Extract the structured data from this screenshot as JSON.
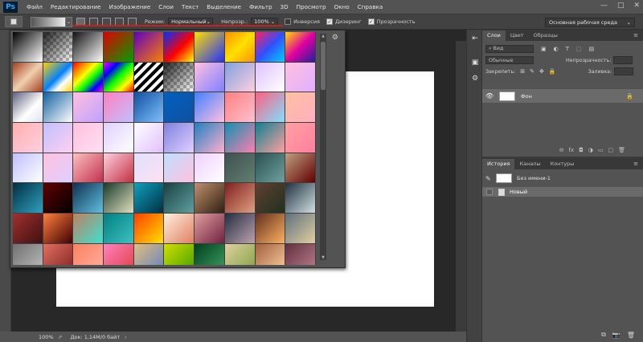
{
  "app": {
    "logo": "Ps"
  },
  "menu": [
    "Файл",
    "Редактирование",
    "Изображение",
    "Слои",
    "Текст",
    "Выделение",
    "Фильтр",
    "3D",
    "Просмотр",
    "Окно",
    "Справка"
  ],
  "window_controls": {
    "minimize": "—",
    "maximize": "□",
    "close": "✕"
  },
  "options": {
    "mode_label": "Режим:",
    "mode_value": "Нормальный",
    "opacity_label": "Непрозр.:",
    "opacity_value": "100%",
    "inverse_label": "Инверсия",
    "dither_label": "Дизеринг",
    "transparency_label": "Прозрачность",
    "inverse_checked": false,
    "dither_checked": true,
    "transparency_checked": true,
    "workspace": "Основная рабочая среда",
    "dropdown_arrow": "⌄",
    "underline_color": "#c8201f"
  },
  "gradient_picker": {
    "gear": "⚙",
    "scroll_up": "▲",
    "scroll_down": "▼",
    "rows": [
      [
        "linear-gradient(135deg,#000 0%,#fff 100%)",
        "checker",
        "linear-gradient(135deg,#111 0%,#fff 100%)",
        "linear-gradient(135deg,#e00000 0%,#00a000 100%)",
        "linear-gradient(135deg,#6000c0 0%,#ff8000 100%)",
        "linear-gradient(135deg,#0030ff 0%,#ff0000 55%,#ffff00 100%)",
        "linear-gradient(135deg,#ffe000 0%,#2030ff 100%)",
        "linear-gradient(135deg,#ff9000 0%,#ffe000 50%,#ff9000 100%)",
        "linear-gradient(135deg,#ff2060 0%,#3050ff 50%,#00d0ff 100%)",
        "linear-gradient(135deg,#ffe000 0%,#e000a0 50%,#2020a0 100%)"
      ],
      [
        "linear-gradient(135deg,#a04020 0%,#f0d0b0 50%,#a04020 100%)",
        "linear-gradient(135deg,#ffd000 0%,#0080ff 50%,#fff 70%,#ffd000 100%)",
        "linear-gradient(135deg,#ff0000,#ff8000,#ffff00,#00ff00,#0000ff,#ff00ff)",
        "linear-gradient(135deg,#ff00ff,#0000ff,#00ff00,#ffff00,#ff0000)",
        "repeating-linear-gradient(135deg,#000 0,#000 4px,#fff 4px,#fff 8px)",
        "checker",
        "linear-gradient(135deg,#ffc0e0 0%,#8080ff 100%)",
        "linear-gradient(135deg,#80a0e0 0%,#ffd0e0 100%)",
        "linear-gradient(135deg,#e0c0ff 0%,#ffffff 100%)",
        "linear-gradient(135deg,#ffc0e0 0%,#e0b0ff 100%)"
      ],
      [
        "linear-gradient(135deg,#606080 0%,#ffffff 60%,#e0e0f0 100%)",
        "linear-gradient(135deg,#1060a0 0%,#ffffff 100%)",
        "linear-gradient(135deg,#ffc0e0 0%,#c0a0ff 100%)",
        "linear-gradient(135deg,#ff80c0 0%,#c0c0ff 100%)",
        "linear-gradient(135deg,#1050a0 0%,#80c0ff 100%)",
        "linear-gradient(135deg,#0060c0 0%,#1050a0 100%)",
        "linear-gradient(135deg,#4080ff 0%,#ffc0e0 100%)",
        "linear-gradient(135deg,#ff8080 0%,#ffc0d0 100%)",
        "linear-gradient(135deg,#ff6080 0%,#80e0ff 100%)",
        "linear-gradient(135deg,#ffc0a0 0%,#ffb0c0 100%)"
      ],
      [
        "linear-gradient(135deg,#ffb0b0 0%,#ffd0e0 100%)",
        "linear-gradient(135deg,#c0c0ff 0%,#ffd0f0 100%)",
        "linear-gradient(135deg,#ffc0e0 0%,#ffe0f0 100%)",
        "linear-gradient(135deg,#e0d0ff 0%,#ffffff 100%)",
        "linear-gradient(135deg,#ffffff 0%,#e0c0ff 100%)",
        "linear-gradient(135deg,#8080e0 0%,#e0d0ff 100%)",
        "linear-gradient(135deg,#2080c0 0%,#ffb0d0 100%)",
        "linear-gradient(135deg,#1090b0 0%,#ff80b0 100%)",
        "linear-gradient(135deg,#108090 0%,#ffa0a0 100%)",
        "linear-gradient(135deg,#ffa0a0 0%,#ff80a0 100%)"
      ],
      [
        "linear-gradient(135deg,#c0c0ff 0%,#ffffff 100%)",
        "linear-gradient(135deg,#ffc0e0 0%,#e0d0ff 100%)",
        "linear-gradient(135deg,#ffc0c0 0%,#c03050 100%)",
        "linear-gradient(135deg,#ffd0e0 0%,#c03040 100%)",
        "linear-gradient(135deg,#e0e0ff 0%,#ffe0f0 100%)",
        "linear-gradient(135deg,#c0e0ff 0%,#ffc0e0 100%)",
        "linear-gradient(135deg,#f0d0ff 0%,#ffffff 100%)",
        "linear-gradient(135deg,#405050 0%,#608070 100%)",
        "linear-gradient(135deg,#2a5050 0%,#70a0a0 100%)",
        "linear-gradient(135deg,#c0a080 0%,#600000 100%)"
      ],
      [
        "linear-gradient(135deg,#003040 0%,#30a0c0 100%)",
        "linear-gradient(135deg,#600000 0%,#000000 100%)",
        "linear-gradient(135deg,#103050 0%,#60c0e0 100%)",
        "linear-gradient(135deg,#1a3a2a 0%,#e0e0c0 100%)",
        "linear-gradient(135deg,#10a0c0 0%,#003040 100%)",
        "linear-gradient(135deg,#1a4040 0%,#60a0a0 100%)",
        "linear-gradient(135deg,#c09070 0%,#302010 100%)",
        "linear-gradient(135deg,#802020 0%,#e0a080 100%)",
        "linear-gradient(135deg,#604030 0%,#203020 100%)",
        "linear-gradient(135deg,#203040 0%,#d0e0e0 100%)"
      ],
      [
        "linear-gradient(135deg,#a03030 0%,#401010 100%)",
        "linear-gradient(135deg,#ff8040 0%,#400000 100%)",
        "linear-gradient(135deg,#c08060 0%,#40e0d0 100%)",
        "linear-gradient(135deg,#008080 0%,#40c0c0 100%)",
        "linear-gradient(135deg,#ff4000 0%,#ffe000 100%)",
        "linear-gradient(135deg,#fff0e0 0%,#e08060 100%)",
        "linear-gradient(135deg,#e0a0a0 0%,#702040 100%)",
        "linear-gradient(135deg,#203040 0%,#c0a0b0 100%)",
        "linear-gradient(135deg,#603020 0%,#ffb060 100%)",
        "linear-gradient(135deg,#607080 0%,#e0d0a0 100%)"
      ],
      [
        "linear-gradient(135deg,#707070 0%,#c0c0c0 100%)",
        "linear-gradient(135deg,#e07060 0%,#802020 100%)",
        "linear-gradient(135deg,#ff8060 0%,#ffb0a0 100%)",
        "linear-gradient(135deg,#ff80c0 0%,#e04040 100%)",
        "linear-gradient(135deg,#e0c080 0%,#6080c0 100%)",
        "linear-gradient(135deg,#d0e000 0%,#40a000 100%)",
        "linear-gradient(135deg,#004020 0%,#40a060 100%)",
        "linear-gradient(135deg,#e0d0a0 0%,#80a040 100%)",
        "linear-gradient(135deg,#a06040 0%,#ffd0a0 100%)",
        "linear-gradient(135deg,#603040 0%,#c08090 100%)"
      ]
    ]
  },
  "document": {
    "canvas_color": "#ffffff"
  },
  "status": {
    "zoom": "100%",
    "doc_size": "Док: 1,14M/0 байт",
    "export_icon": "⇗",
    "arrow": "›"
  },
  "dock": {
    "icons": [
      "⇤",
      "▣",
      "⚙"
    ]
  },
  "layers_panel": {
    "tabs": [
      "Слои",
      "Цвет",
      "Образцы"
    ],
    "menu": "≡",
    "filter_label": "⌕ Вид",
    "filter_icons": [
      "▣",
      "◐",
      "T",
      "⬚",
      "▤"
    ],
    "blend_mode": "Обычные",
    "opacity_label": "Непрозрачность:",
    "lock_label": "Закрепить:",
    "lock_icons": [
      "⊞",
      "✎",
      "✥",
      "🔒"
    ],
    "fill_label": "Заливка:",
    "layer_name": "Фон",
    "layer_eye": "👁",
    "layer_lock": "🔒",
    "footer_icons": [
      "⊖",
      "fx",
      "◘",
      "◑",
      "▭",
      "▢",
      "🗑"
    ]
  },
  "history_panel": {
    "tabs": [
      "История",
      "Каналы",
      "Контуры"
    ],
    "menu": "≡",
    "snapshot_name": "Без имени-1",
    "snapshot_brush": "✎",
    "state_label": "Новый",
    "footer_icons": [
      "⧉",
      "📷",
      "🗑"
    ]
  }
}
